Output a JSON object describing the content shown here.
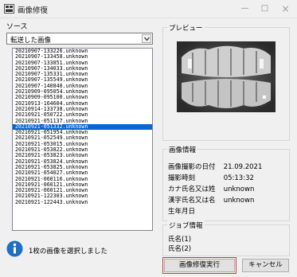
{
  "window": {
    "title": "画像修復",
    "close_glyph": "×",
    "max_glyph": "□",
    "min_glyph": "—"
  },
  "source": {
    "label": "ソース",
    "selected": "転送した画像",
    "items": [
      "20210907-133226.unknown",
      "20210907-133458.unknown",
      "20210907-133851.unknown",
      "20210907-134033.unknown",
      "20210907-135331.unknown",
      "20210907-135549.unknown",
      "20210907-140840.unknown",
      "20210909-095054.unknown",
      "20210909-095100.unknown",
      "20210913-164604.unknown",
      "20210914-133738.unknown",
      "20210921-050722.unknown",
      "20210921-051137.unknown",
      "20210921-051332.unknown",
      "20210921-051954.unknown",
      "20210921-052549.unknown",
      "20210921-053015.unknown",
      "20210921-053822.unknown",
      "20210921-053823.unknown",
      "20210921-053824.unknown",
      "20210921-053825.unknown",
      "20210921-054027.unknown",
      "20210921-060116.unknown",
      "20210921-060121.unknown",
      "20210921-060121.unknown",
      "20210921-122303.unknown",
      "20210921-122443.unknown"
    ],
    "selected_index": 13
  },
  "status_message": "1枚の画像を選択しました",
  "preview": {
    "legend": "プレビュー"
  },
  "image_info": {
    "legend": "画像情報",
    "rows": [
      {
        "key": "画像撮影の日付",
        "value": "21.09.2021"
      },
      {
        "key": "撮影時刻",
        "value": "05:13:32"
      },
      {
        "key": "カナ氏名又は姓",
        "value": "unknown"
      },
      {
        "key": "漢字氏名又は名",
        "value": "unknown"
      },
      {
        "key": "生年月日",
        "value": ""
      }
    ]
  },
  "job_info": {
    "legend": "ジョブ情報",
    "rows": [
      {
        "key": "氏名(1)"
      },
      {
        "key": "氏名(2)"
      }
    ]
  },
  "buttons": {
    "execute": "画像修復実行",
    "cancel": "キャンセル"
  },
  "colors": {
    "selection": "#0a64d6",
    "highlight_outline": "#d9343a",
    "info_icon": "#1f6fc4"
  }
}
